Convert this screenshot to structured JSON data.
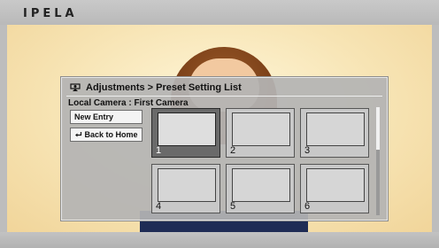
{
  "brand": {
    "logo_text": "IPELA"
  },
  "panel": {
    "title": "Adjustments > Preset Setting List",
    "title_icon": "camera-icon",
    "camera_line": "Local Camera : First Camera"
  },
  "buttons": {
    "new_entry": "New Entry",
    "back_home": "Back to Home",
    "back_home_icon": "return-arrow-icon"
  },
  "presets": {
    "selected": "1",
    "items": [
      {
        "number": "1"
      },
      {
        "number": "2"
      },
      {
        "number": "3"
      },
      {
        "number": "4"
      },
      {
        "number": "5"
      },
      {
        "number": "6"
      }
    ]
  },
  "colors": {
    "panel_bg": "#b4b4b4",
    "selected_tile": "#6a6a6a",
    "top_bar": "#c2c2c2"
  }
}
